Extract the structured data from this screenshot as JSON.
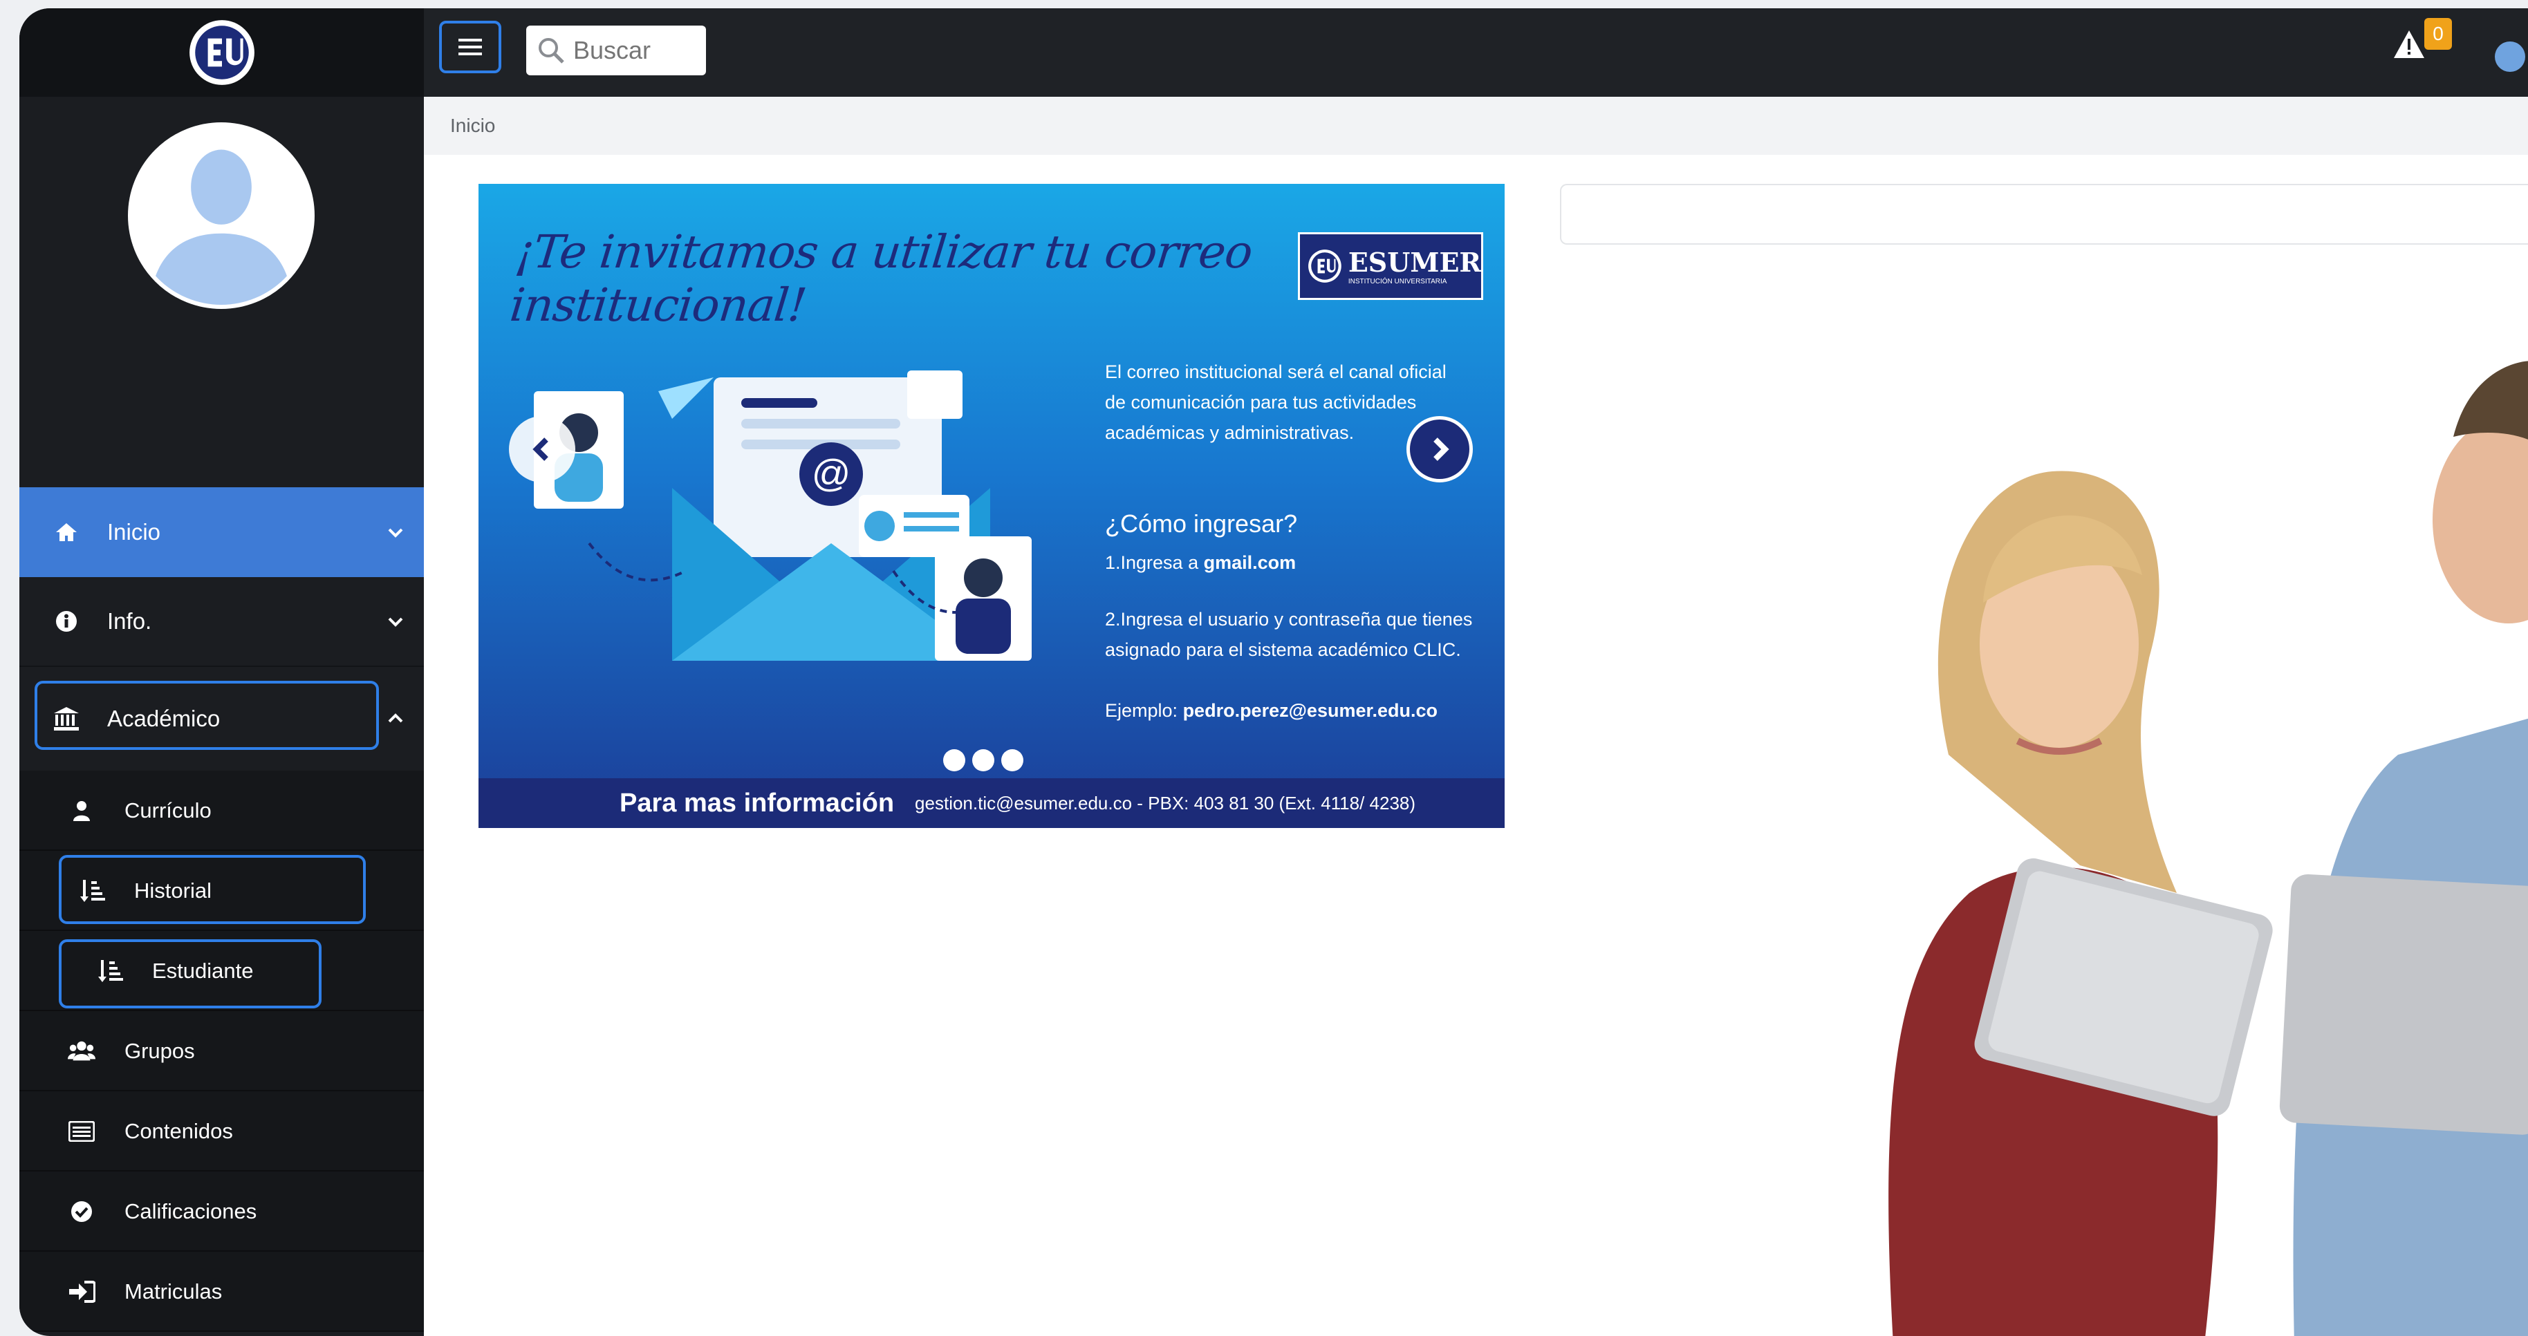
{
  "sidebar": {
    "nav": [
      {
        "label": "Inicio",
        "icon": "home-icon"
      },
      {
        "label": "Info.",
        "icon": "info-icon"
      },
      {
        "label": "Académico",
        "icon": "institution-icon"
      }
    ],
    "academico_items": [
      {
        "label": "Currículo",
        "icon": "user-icon"
      },
      {
        "label": "Historial",
        "icon": "sort-list-icon"
      },
      {
        "label": "Estudiante",
        "icon": "sort-list-icon"
      },
      {
        "label": "Grupos",
        "icon": "users-icon"
      },
      {
        "label": "Contenidos",
        "icon": "list-card-icon"
      },
      {
        "label": "Calificaciones",
        "icon": "check-circle-icon"
      },
      {
        "label": "Matriculas",
        "icon": "sign-in-icon"
      }
    ]
  },
  "topbar": {
    "search_placeholder": "Buscar",
    "notification_count": "0"
  },
  "breadcrumb": "Inicio",
  "banner": {
    "title": "¡Te invitamos a utilizar tu correo institucional!",
    "logo_text": "ESUMER",
    "logo_subtext": "INSTITUCIÓN UNIVERSITARIA",
    "intro": [
      "El correo institucional será el canal oficial",
      "de comunicación para tus actividades",
      "académicas y administrativas."
    ],
    "how_title": "¿Cómo ingresar?",
    "step1_prefix": "1.Ingresa a ",
    "step1_bold": "gmail.com",
    "step2": [
      "2.Ingresa el usuario y contraseña que tienes",
      "asignado para el sistema académico CLIC."
    ],
    "example_prefix": "Ejemplo: ",
    "example_bold": "pedro.perez@esumer.edu.co",
    "footer_label": "Para mas información",
    "footer_contact": "gestion.tic@esumer.edu.co - PBX: 403 81 30  (Ext. 4118/ 4238)"
  },
  "colors": {
    "sidebar_bg": "#1b1d21",
    "active_nav": "#3e7bd6",
    "focus_outline": "#2f7fe8",
    "badge": "#f0a21a",
    "banner_dark": "#1c2b78"
  }
}
